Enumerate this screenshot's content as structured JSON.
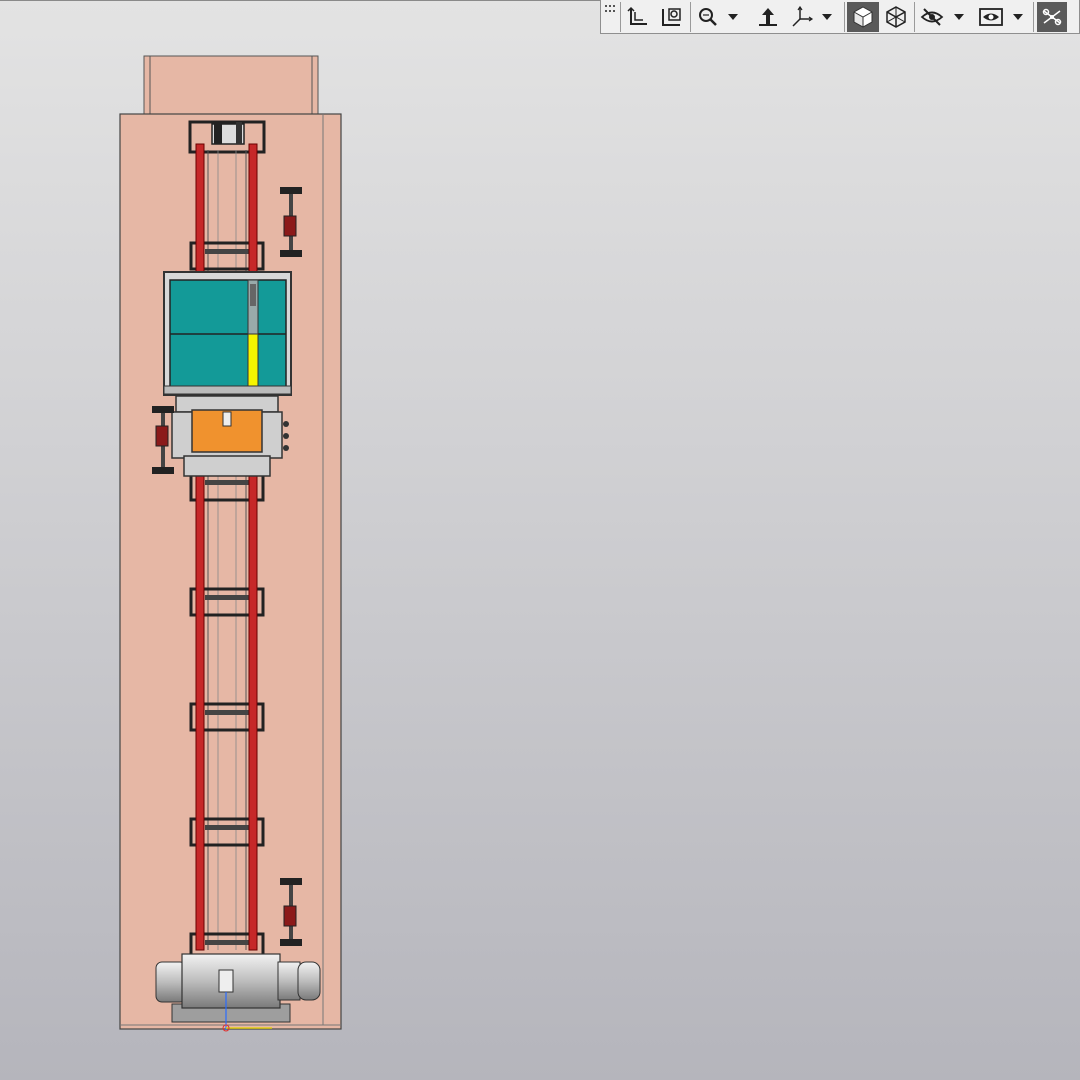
{
  "toolbar": {
    "buttons": [
      {
        "icon": "show-all-icon",
        "active": false
      },
      {
        "icon": "zoom-window-icon",
        "active": false
      },
      {
        "icon": "zoom-scale-icon",
        "active": false,
        "dropdown": true
      },
      {
        "icon": "rotate-icon",
        "active": false
      },
      {
        "icon": "orientation-icon",
        "active": false,
        "dropdown": true
      },
      {
        "icon": "shaded-mode-icon",
        "active": true
      },
      {
        "icon": "wireframe-mode-icon",
        "active": false
      },
      {
        "icon": "hide-icon",
        "active": false,
        "dropdown": true
      },
      {
        "icon": "visibility-icon",
        "active": false,
        "dropdown": true
      },
      {
        "icon": "constraints-icon",
        "active": true
      }
    ]
  },
  "colors": {
    "background_top": "#e3e3e3",
    "background_bottom": "#b5b5bc",
    "housing": "#e6b7a5",
    "rail": "#c62828",
    "panel": "#139a98",
    "indicator": "#f5f500",
    "carriage": "#f0922e",
    "motor": "#c8c8c8"
  }
}
